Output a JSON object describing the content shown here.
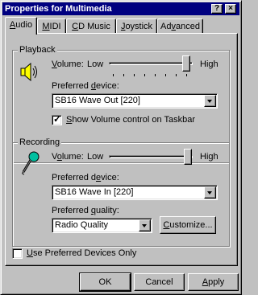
{
  "window": {
    "title": "Properties for Multimedia",
    "help_button": "?",
    "close_button": "×"
  },
  "tabs": [
    {
      "label_pre": "",
      "label_key": "A",
      "label_post": "udio",
      "active": true
    },
    {
      "label_pre": "",
      "label_key": "M",
      "label_post": "IDI",
      "active": false
    },
    {
      "label_pre": "",
      "label_key": "C",
      "label_post": "D Music",
      "active": false
    },
    {
      "label_pre": "",
      "label_key": "J",
      "label_post": "oystick",
      "active": false
    },
    {
      "label_pre": "Ad",
      "label_key": "v",
      "label_post": "anced",
      "active": false
    }
  ],
  "playback": {
    "group_label": "Playback",
    "volume_pre": "",
    "volume_key": "V",
    "volume_post": "olume:",
    "low_label": "Low",
    "high_label": "High",
    "volume_level": 0.95,
    "device_pre": "Preferred ",
    "device_key": "d",
    "device_post": "evice:",
    "device_value": "SB16 Wave Out [220]",
    "show_volume_pre": "",
    "show_volume_key": "S",
    "show_volume_post": "how Volume control on Taskbar",
    "show_volume_checked": true
  },
  "recording": {
    "group_label": "Recording",
    "volume_pre": "V",
    "volume_key": "o",
    "volume_post": "lume:",
    "low_label": "Low",
    "high_label": "High",
    "volume_level": 0.97,
    "device_pre": "Preferred d",
    "device_key": "e",
    "device_post": "vice:",
    "device_value": "SB16 Wave In [220]",
    "quality_pre": "Preferred ",
    "quality_key": "q",
    "quality_post": "uality:",
    "quality_value": "Radio Quality",
    "customize_pre": "",
    "customize_key": "C",
    "customize_post": "ustomize..."
  },
  "use_preferred": {
    "label_pre": "",
    "label_key": "U",
    "label_post": "se Preferred Devices Only",
    "checked": false
  },
  "buttons": {
    "ok": "OK",
    "cancel": "Cancel",
    "apply_pre": "",
    "apply_key": "A",
    "apply_post": "pply"
  },
  "checkmark": "✓"
}
